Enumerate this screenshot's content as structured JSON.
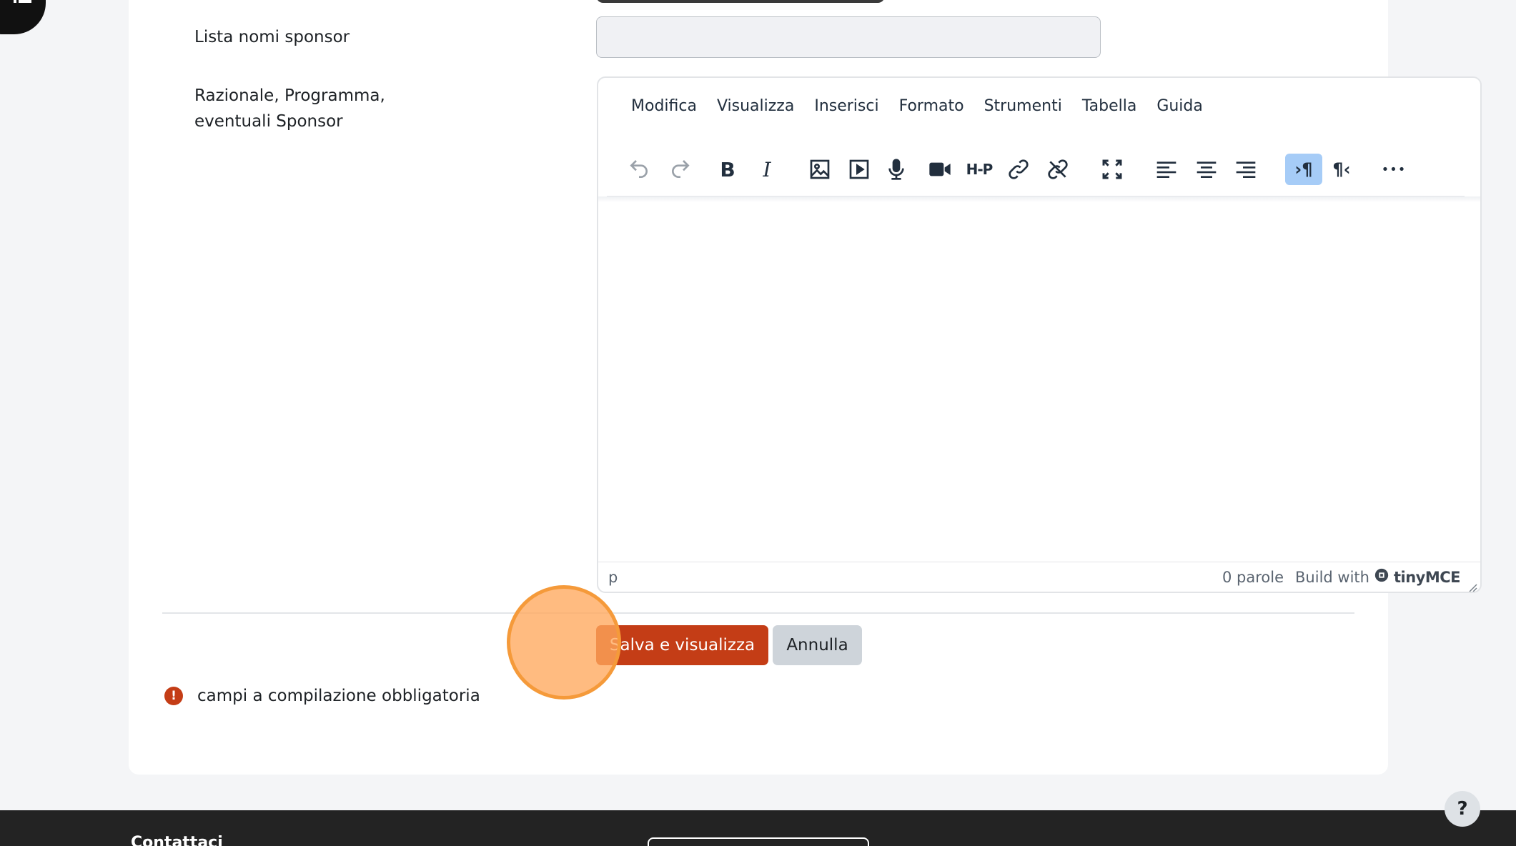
{
  "form": {
    "sponsor_label": "Lista nomi sponsor",
    "sponsor_value": "",
    "rationale_label_line1": "Razionale, Programma,",
    "rationale_label_line2": "eventuali Sponsor"
  },
  "editor": {
    "menu": [
      "Modifica",
      "Visualizza",
      "Inserisci",
      "Formato",
      "Strumenti",
      "Tabella",
      "Guida"
    ],
    "toolbar_icons": [
      "undo-icon",
      "redo-icon",
      "bold-icon",
      "italic-icon",
      "image-icon",
      "media-icon",
      "microphone-icon",
      "video-camera-icon",
      "h5p-icon",
      "link-icon",
      "unlink-icon",
      "fullscreen-icon",
      "align-left-icon",
      "align-center-icon",
      "align-right-icon",
      "ltr-icon",
      "rtl-icon",
      "more-icon"
    ],
    "active_tool": "ltr-icon",
    "bold_glyph": "B",
    "italic_glyph": "I",
    "h5p_glyph": "H-P",
    "ltr_glyph": "›¶",
    "rtl_glyph": "¶‹",
    "more_glyph": "•••",
    "status_path": "p",
    "word_count": "0 parole",
    "build_with": "Build with",
    "brand": "tinyMCE"
  },
  "actions": {
    "save_label": "Salva e visualizza",
    "cancel_label": "Annulla"
  },
  "required_note": {
    "icon": "!",
    "text": "campi a compilazione obbligatoria"
  },
  "footer": {
    "title": "Contattaci"
  },
  "help": {
    "label": "?"
  },
  "colors": {
    "primary": "#c43d16",
    "secondary": "#ced4da",
    "active_tool_bg": "#a6ccf7",
    "click_marker": "#f59a3a",
    "footer_bg": "#232323"
  }
}
